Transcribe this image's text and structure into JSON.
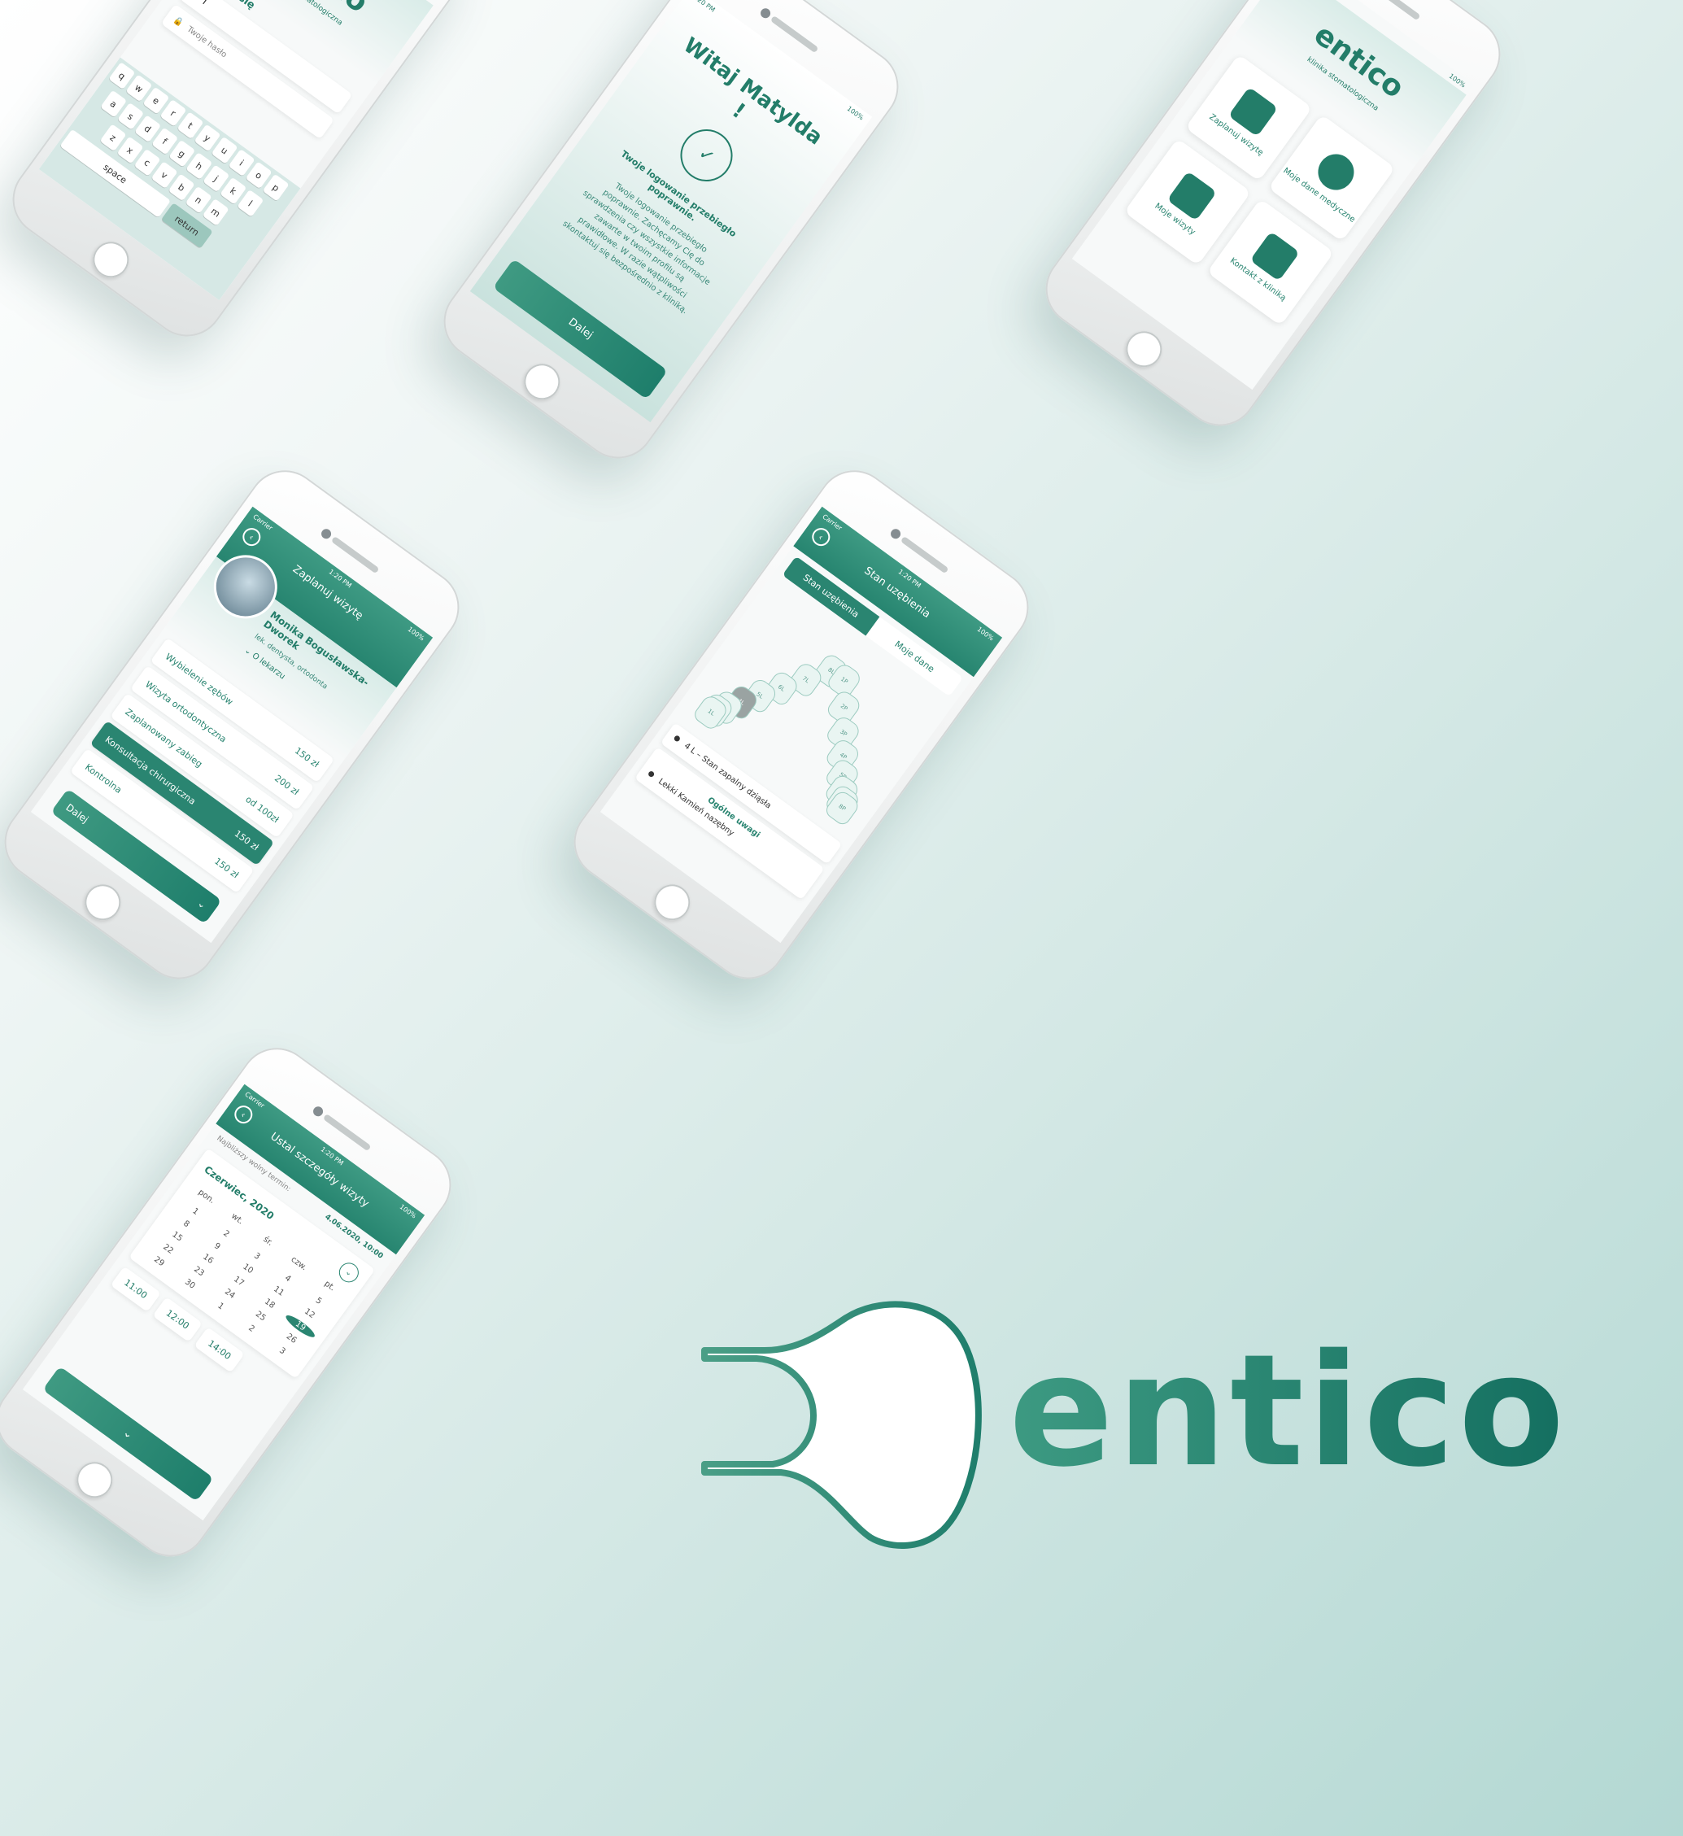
{
  "status": {
    "time": "1:20 PM",
    "carrier": "Carrier",
    "battery": "100%"
  },
  "brand": {
    "name": "entico",
    "tagline": "klinika stomatologiczna"
  },
  "login": {
    "title": "Zaloguj się",
    "email_value": "I",
    "password_placeholder": "Twoje hasło",
    "keyboard_row1": [
      "q",
      "w",
      "e",
      "r",
      "t",
      "y",
      "u",
      "i",
      "o",
      "p"
    ],
    "keyboard_row2": [
      "a",
      "s",
      "d",
      "f",
      "g",
      "h",
      "j",
      "k",
      "l"
    ],
    "keyboard_row3": [
      "z",
      "x",
      "c",
      "v",
      "b",
      "n",
      "m"
    ],
    "space": "space",
    "return": "return"
  },
  "welcome": {
    "greeting": "Witaj Matylda !",
    "headline": "Twoje logowanie przebiegło poprawnie.",
    "body": "Twoje logowanie przebiegło poprawnie. Zachęcamy Cię do sprawdzenia czy wszystkie informacje zawarte w twoim profilu są prawidłowe. W razie wątpliwości skontaktuj się bezpośrednio z kliniką.",
    "button": "Dalej"
  },
  "menu": {
    "tiles": [
      {
        "label": "Zaplanuj wizytę",
        "icon": "notebook-icon"
      },
      {
        "label": "Moje dane medyczne",
        "icon": "person-icon"
      },
      {
        "label": "Moje wizyty",
        "icon": "calendar-icon"
      },
      {
        "label": "Kontakt z kliniką",
        "icon": "contacts-icon"
      }
    ]
  },
  "plan": {
    "title": "Zaplanuj wizytę",
    "doctor_name": "Monika Bogusławska-Dworek",
    "doctor_role": "lek. dentysta, ortodonta",
    "about": "O lekarzu",
    "services": [
      {
        "name": "Wybielenie zębów",
        "price": "150 zł"
      },
      {
        "name": "Wizyta ortodontyczna",
        "price": "200 zł"
      },
      {
        "name": "Zaplanowany zabieg",
        "price": "od 100zł"
      },
      {
        "name": "Konsultacja chirurgiczna",
        "price": "150 zł"
      },
      {
        "name": "Kontrolna",
        "price": "150 zł"
      }
    ],
    "button": "Dalej"
  },
  "teeth": {
    "title": "Stan uzębienia",
    "tabs": [
      "Stan uzębienia",
      "Moje dane"
    ],
    "left": [
      "8L",
      "7L",
      "6L",
      "5L",
      "4L",
      "3L",
      "2L",
      "1L"
    ],
    "right": [
      "1P",
      "2P",
      "3P",
      "4P",
      "5P",
      "6P",
      "7P",
      "8P"
    ],
    "note": "4 L – Stan zapalny dziąsła",
    "general_title": "Ogólne uwagi",
    "general_note": "Lekki Kamień nazębny"
  },
  "schedule": {
    "title": "Ustal szczegóły wizyty",
    "nearest_label": "Najbliższy wolny termin:",
    "nearest_value": "4.06.2020, 10:00",
    "month": "Czerwiec, 2020",
    "weekdays": [
      "pon.",
      "wt.",
      "śr.",
      "czw.",
      "pt."
    ],
    "days": [
      "1",
      "2",
      "3",
      "4",
      "5",
      "8",
      "9",
      "10",
      "11",
      "12",
      "15",
      "16",
      "17",
      "18",
      "19",
      "22",
      "23",
      "24",
      "25",
      "26",
      "29",
      "30",
      "1",
      "2",
      "3"
    ],
    "selected_day": "19",
    "times": [
      "11:00",
      "12:00",
      "14:00"
    ]
  }
}
